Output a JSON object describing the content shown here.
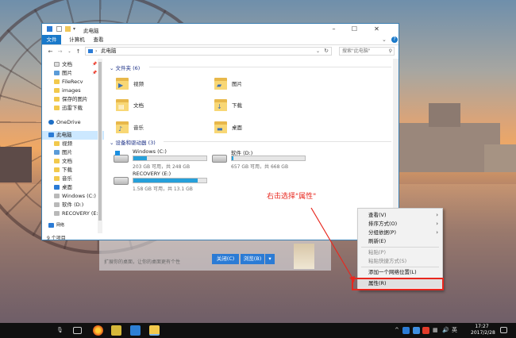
{
  "window": {
    "title": "此电脑",
    "quick_access_dropdown": "▾",
    "tabs": [
      "文件",
      "计算机",
      "查看"
    ],
    "address": "此电脑",
    "search_placeholder": "搜索\"此电脑\"",
    "status": "9 个项目"
  },
  "nav_pane": {
    "items": [
      {
        "label": "文档",
        "pinned": true
      },
      {
        "label": "图片",
        "pinned": true
      },
      {
        "label": "FileRecv"
      },
      {
        "label": "images"
      },
      {
        "label": "保存的图片"
      },
      {
        "label": "迅雷下载"
      },
      {
        "label": "OneDrive"
      },
      {
        "label": "此电脑",
        "selected": true
      },
      {
        "label": "视频"
      },
      {
        "label": "图片"
      },
      {
        "label": "文档"
      },
      {
        "label": "下载"
      },
      {
        "label": "音乐"
      },
      {
        "label": "桌面"
      },
      {
        "label": "Windows (C:)"
      },
      {
        "label": "软件 (D:)"
      },
      {
        "label": "RECOVERY (E:)"
      },
      {
        "label": "网络"
      }
    ]
  },
  "folders_section": {
    "header": "文件夹 (6)",
    "items": [
      {
        "label": "视频",
        "icon": "video-folder-icon"
      },
      {
        "label": "图片",
        "icon": "pictures-folder-icon"
      },
      {
        "label": "文档",
        "icon": "documents-folder-icon"
      },
      {
        "label": "下载",
        "icon": "downloads-folder-icon"
      },
      {
        "label": "音乐",
        "icon": "music-folder-icon"
      },
      {
        "label": "桌面",
        "icon": "desktop-folder-icon"
      }
    ]
  },
  "drives_section": {
    "header": "设备和驱动器 (3)",
    "drives": [
      {
        "name": "Windows (C:)",
        "info": "203 GB 可用，共 248 GB",
        "used_fraction": 0.18
      },
      {
        "name": "软件 (D:)",
        "info": "657 GB 可用，共 668 GB",
        "used_fraction": 0.02
      },
      {
        "name": "RECOVERY (E:)",
        "info": "1.58 GB 可用，共 13.1 GB",
        "used_fraction": 0.88
      }
    ]
  },
  "banner": {
    "text": "扩展你的桌面，让你的桌面更有个性",
    "close_label": "关闭(C)",
    "browse_label": "浏览(B)"
  },
  "annotation": "右击选择\"属性\"",
  "context_menu": {
    "items": [
      {
        "label": "查看(V)",
        "submenu": true,
        "disabled": false
      },
      {
        "label": "排序方式(O)",
        "submenu": true,
        "disabled": false
      },
      {
        "label": "分组依据(P)",
        "submenu": true,
        "disabled": false
      },
      {
        "label": "刷新(E)",
        "submenu": false,
        "disabled": false
      },
      {
        "label": "粘贴(P)",
        "submenu": false,
        "disabled": true
      },
      {
        "label": "粘贴快捷方式(S)",
        "submenu": false,
        "disabled": true
      },
      {
        "label": "添加一个网络位置(L)",
        "submenu": false,
        "disabled": false
      },
      {
        "label": "属性(R)",
        "submenu": false,
        "disabled": false
      }
    ]
  },
  "taskbar": {
    "ime": "英",
    "time": "17:27",
    "date": "2017/2/28",
    "tray_expand": "^"
  },
  "colors": {
    "accent": "#1979ca",
    "selection": "#cce8ff",
    "drive_bar": "#26a0da",
    "annotation": "#e8271e"
  }
}
